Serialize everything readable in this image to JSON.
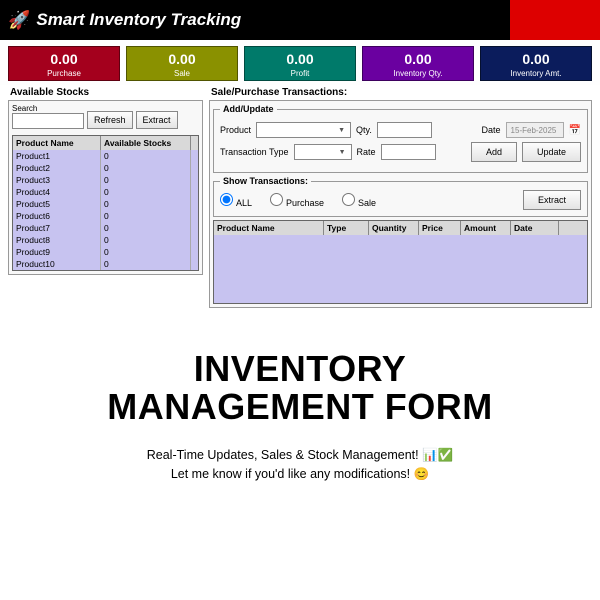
{
  "header": {
    "title": "Smart Inventory Tracking"
  },
  "kpis": [
    {
      "value": "0.00",
      "label": "Purchase"
    },
    {
      "value": "0.00",
      "label": "Sale"
    },
    {
      "value": "0.00",
      "label": "Profit"
    },
    {
      "value": "0.00",
      "label": "Inventory Qty."
    },
    {
      "value": "0.00",
      "label": "Inventory Amt."
    }
  ],
  "left": {
    "title": "Available Stocks",
    "search_label": "Search",
    "refresh": "Refresh",
    "extract": "Extract",
    "cols": {
      "name": "Product Name",
      "stock": "Available Stocks"
    },
    "rows": [
      {
        "name": "Product1",
        "stock": "0"
      },
      {
        "name": "Product2",
        "stock": "0"
      },
      {
        "name": "Product3",
        "stock": "0"
      },
      {
        "name": "Product4",
        "stock": "0"
      },
      {
        "name": "Product5",
        "stock": "0"
      },
      {
        "name": "Product6",
        "stock": "0"
      },
      {
        "name": "Product7",
        "stock": "0"
      },
      {
        "name": "Product8",
        "stock": "0"
      },
      {
        "name": "Product9",
        "stock": "0"
      },
      {
        "name": "Product10",
        "stock": "0"
      }
    ]
  },
  "right": {
    "title": "Sale/Purchase Transactions:",
    "addupdate": {
      "legend": "Add/Update",
      "product": "Product",
      "qty": "Qty.",
      "date": "Date",
      "date_value": "15-Feb-2025",
      "txn_type": "Transaction Type",
      "rate": "Rate",
      "add": "Add",
      "update": "Update"
    },
    "show": {
      "legend": "Show Transactions:",
      "all": "ALL",
      "purchase": "Purchase",
      "sale": "Sale",
      "extract": "Extract"
    },
    "tcols": {
      "name": "Product Name",
      "type": "Type",
      "qty": "Quantity",
      "price": "Price",
      "amount": "Amount",
      "date": "Date"
    }
  },
  "promo": {
    "title1": "INVENTORY",
    "title2": "MANAGEMENT FORM",
    "line1": "Real-Time Updates, Sales & Stock Management! 📊✅",
    "line2": "Let me know if you'd like any modifications! 😊"
  }
}
